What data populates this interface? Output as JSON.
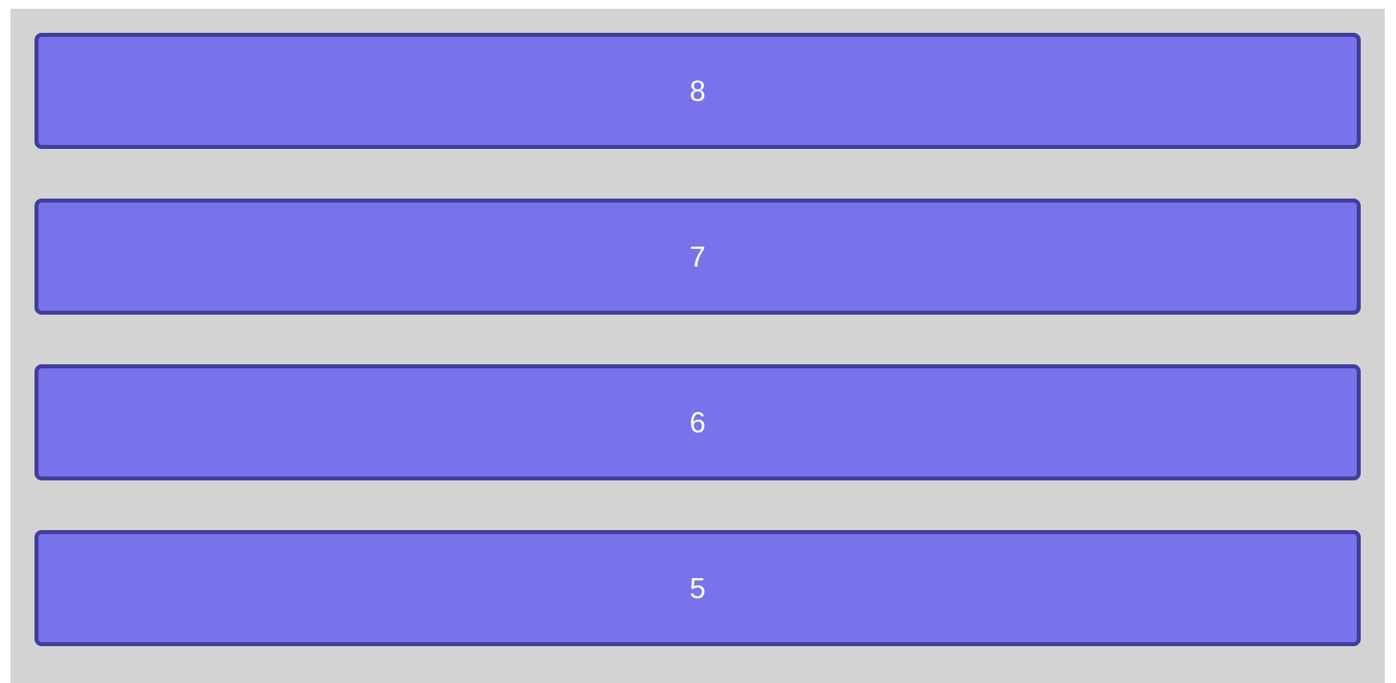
{
  "colors": {
    "panel_background": "#d3d3d3",
    "item_fill": "#7873ea",
    "item_border": "#413e9c",
    "item_text": "#ffffff"
  },
  "list": {
    "items": [
      {
        "label": "8"
      },
      {
        "label": "7"
      },
      {
        "label": "6"
      },
      {
        "label": "5"
      }
    ]
  }
}
